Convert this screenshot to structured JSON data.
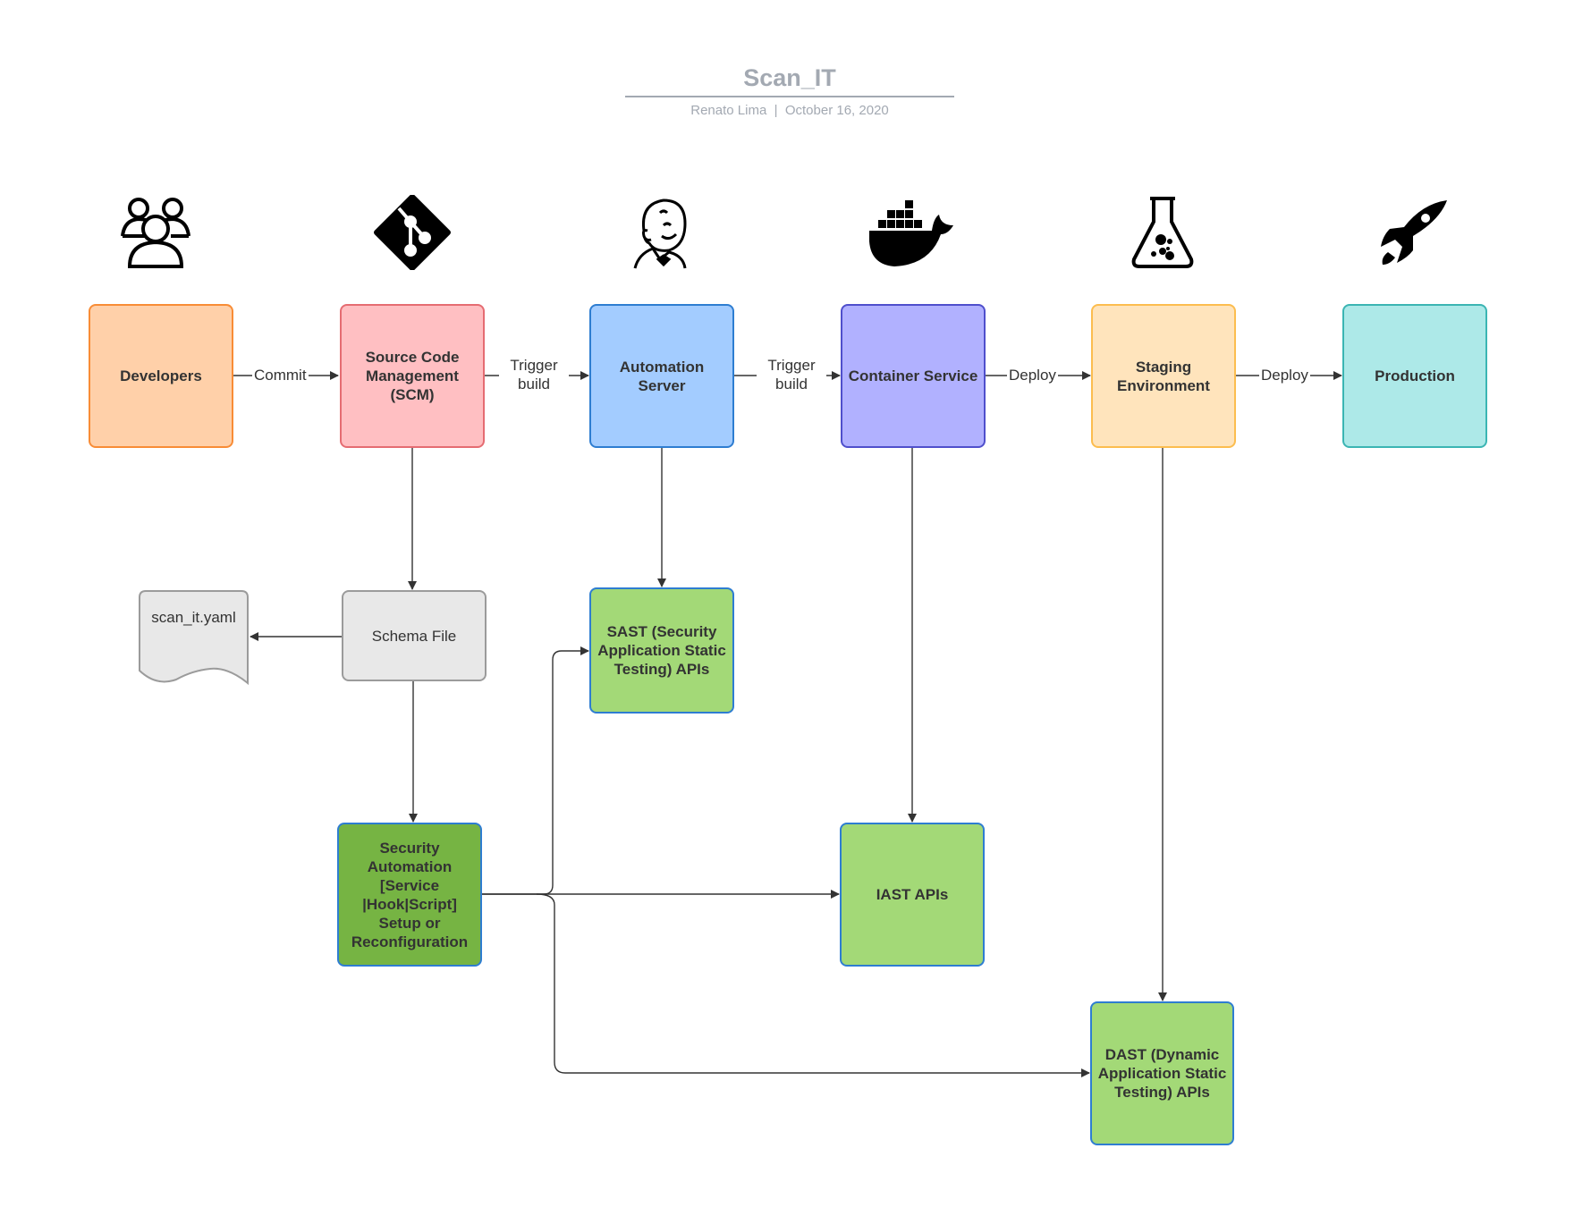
{
  "header": {
    "title": "Scan_IT",
    "author": "Renato Lima",
    "separator": "|",
    "date": "October 16, 2020",
    "subtitle": "Renato Lima  |  October 16, 2020"
  },
  "pipeline": [
    {
      "id": "developers",
      "label": "Developers",
      "icon": "users-icon",
      "fill": "#ffd0a9",
      "border": "#f88c36"
    },
    {
      "id": "scm",
      "label": "Source Code Management (SCM)",
      "icon": "git-icon",
      "fill": "#ffbfc2",
      "border": "#e56c72"
    },
    {
      "id": "automation",
      "label": "Automation Server",
      "icon": "jenkins-icon",
      "fill": "#a3ccff",
      "border": "#2e7dd1"
    },
    {
      "id": "container",
      "label": "Container Service",
      "icon": "docker-icon",
      "fill": "#b1b1ff",
      "border": "#4f4fcc"
    },
    {
      "id": "staging",
      "label": "Staging Environment",
      "icon": "flask-icon",
      "fill": "#ffe4bc",
      "border": "#fcbd4f"
    },
    {
      "id": "production",
      "label": "Production",
      "icon": "rocket-icon",
      "fill": "#ade9e8",
      "border": "#3bb5b3"
    }
  ],
  "edges": {
    "commit": "Commit",
    "trigger_build_1": "Trigger build",
    "trigger_build_2": "Trigger build",
    "deploy_1": "Deploy",
    "deploy_2": "Deploy"
  },
  "nodes": {
    "schema": {
      "label": "Schema File",
      "fill": "#e8e8e8",
      "border": "#9b9b9b"
    },
    "yaml_doc": {
      "label": "scan_it.yaml",
      "fill": "#e8e8e8",
      "border": "#9b9b9b"
    },
    "security_automation": {
      "label": "Security Automation [Service |Hook|Script] Setup or Reconfiguration",
      "fill": "#76b443",
      "border": "#2e7dd1"
    },
    "sast": {
      "label": "SAST (Security Application Static Testing) APIs",
      "fill": "#a3d977",
      "border": "#2e7dd1"
    },
    "iast": {
      "label": "IAST APIs",
      "fill": "#a3d977",
      "border": "#2e7dd1"
    },
    "dast": {
      "label": "DAST (Dynamic Application Static Testing) APIs",
      "fill": "#a3d977",
      "border": "#2e7dd1"
    }
  }
}
